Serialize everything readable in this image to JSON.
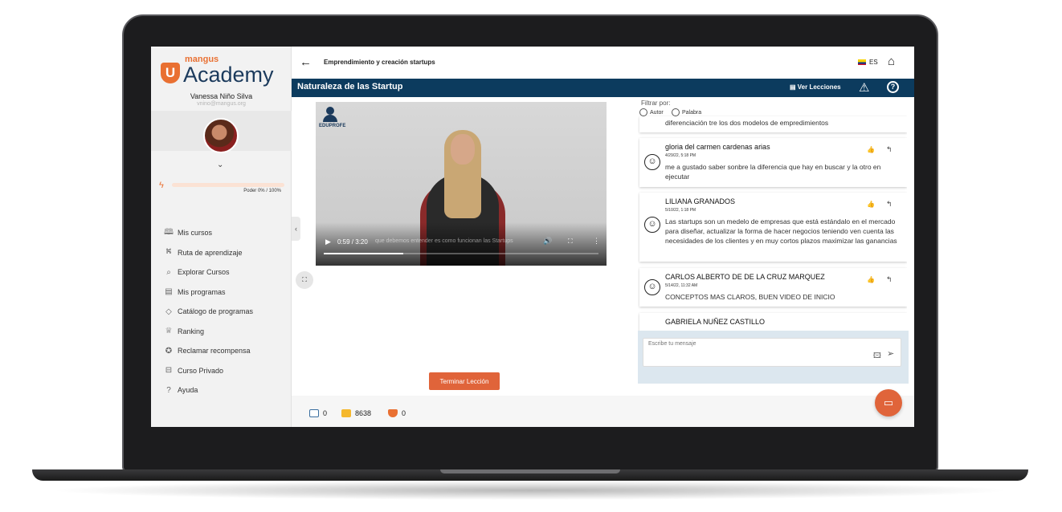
{
  "brand": {
    "small": "mangus",
    "big": "Academy",
    "u_letter": "U"
  },
  "user": {
    "name": "Vanessa Niño Silva",
    "email": "vnino@mangus.org"
  },
  "power": {
    "label": "Poder 0% / 100%",
    "fraction": 0.0
  },
  "nav": [
    {
      "label": "Mis cursos",
      "icon": "book-icon",
      "glyph": "🕮"
    },
    {
      "label": "Ruta de aprendizaje",
      "icon": "route-icon",
      "glyph": "⛕"
    },
    {
      "label": "Explorar Cursos",
      "icon": "explore-icon",
      "glyph": "⌕"
    },
    {
      "label": "Mis programas",
      "icon": "programs-icon",
      "glyph": "▤"
    },
    {
      "label": "Catálogo de programas",
      "icon": "catalog-icon",
      "glyph": "◇"
    },
    {
      "label": "Ranking",
      "icon": "trophy-icon",
      "glyph": "♕"
    },
    {
      "label": "Reclamar recompensa",
      "icon": "reward-icon",
      "glyph": "✪"
    },
    {
      "label": "Curso Privado",
      "icon": "private-course-icon",
      "glyph": "⊟"
    },
    {
      "label": "Ayuda",
      "icon": "help-circle-icon",
      "glyph": "?"
    }
  ],
  "header": {
    "course_title": "Emprendimiento y creación startups",
    "language": "ES"
  },
  "lesson": {
    "title": "Naturaleza de las Startup",
    "ver_lecciones": "Ver Lecciones"
  },
  "video": {
    "brand": "EDUPROFE",
    "time": "0:59 / 3:20",
    "subtitle": "que debemos entender es como funcionan las Startups",
    "progress_fraction": 0.29
  },
  "actions": {
    "finish_lesson": "Terminar Lección"
  },
  "footer": {
    "stat1": "0",
    "stat2": "8638",
    "stat3": "0"
  },
  "filter": {
    "label": "Filtrar por:",
    "option1": "Autor",
    "option2": "Palabra"
  },
  "comments": {
    "first_snippet": "diferenciación tre los dos modelos de empredimientos",
    "items": [
      {
        "author": "gloria del carmen cardenas arias",
        "date": "4/29/22, 5:18 PM",
        "text": "me a gustado saber sonbre la diferencia que hay en buscar y la otro en ejecutar"
      },
      {
        "author": "LILIANA GRANADOS",
        "date": "5/10/22, 1:18 PM",
        "text": "Las startups son un medelo de empresas que está estándalo en el mercado para diseñar, actualizar la forma de hacer negocios teniendo ven cuenta las necesidades de los clientes y en muy cortos plazos maximizar las ganancias"
      },
      {
        "author": "CARLOS ALBERTO DE DE LA CRUZ MARQUEZ",
        "date": "5/14/22, 11:32 AM",
        "text": "CONCEPTOS MAS CLAROS, BUEN VIDEO DE INICIO"
      },
      {
        "author": "GABRIELA NUÑEZ CASTILLO",
        "date": "",
        "text": ""
      }
    ]
  },
  "message": {
    "placeholder": "Escribe tu mensaje"
  }
}
